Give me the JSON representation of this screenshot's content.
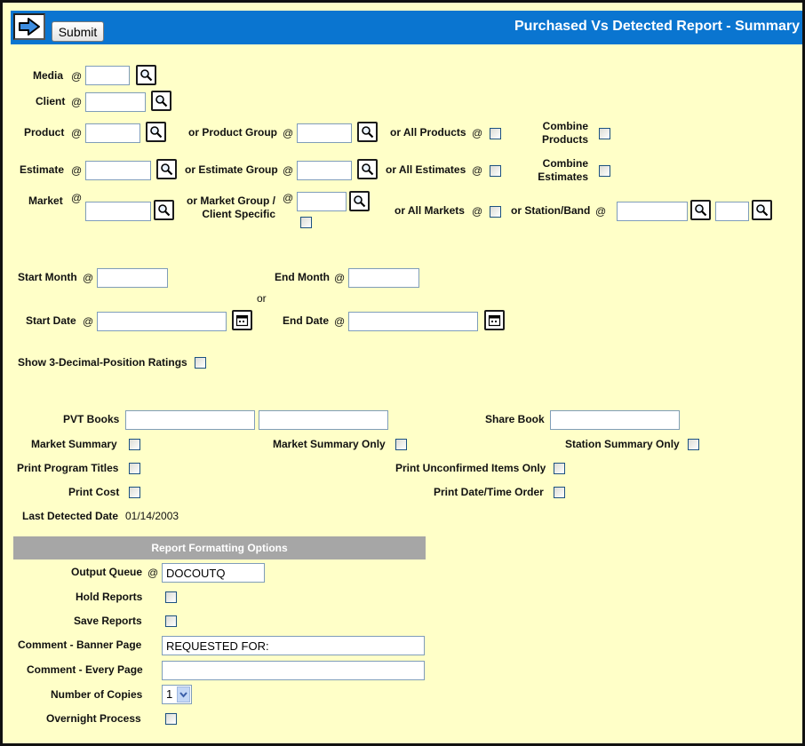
{
  "header": {
    "title": "Purchased Vs Detected Report - Summary",
    "submit_label": "Submit"
  },
  "at": "@",
  "labels": {
    "media": "Media",
    "client": "Client",
    "product": "Product",
    "product_group": "or Product Group",
    "all_products": "or All Products",
    "combine_products_1": "Combine",
    "combine_products_2": "Products",
    "estimate": "Estimate",
    "estimate_group": "or Estimate Group",
    "all_estimates": "or All Estimates",
    "combine_estimates_1": "Combine",
    "combine_estimates_2": "Estimates",
    "market": "Market",
    "market_group_1": "or Market Group /",
    "market_group_2": "Client Specific",
    "all_markets": "or All Markets",
    "station_band": "or Station/Band",
    "start_month": "Start Month",
    "end_month": "End Month",
    "or": "or",
    "start_date": "Start Date",
    "end_date": "End Date",
    "show_3_decimal": "Show 3-Decimal-Position Ratings",
    "pvt_books": "PVT Books",
    "share_book": "Share Book",
    "market_summary": "Market Summary",
    "market_summary_only": "Market Summary Only",
    "station_summary_only": "Station Summary Only",
    "print_program_titles": "Print Program Titles",
    "print_unconfirmed": "Print Unconfirmed Items Only",
    "print_cost": "Print Cost",
    "print_date_time": "Print Date/Time Order",
    "last_detected_date": "Last Detected Date"
  },
  "values": {
    "last_detected_date": "01/14/2003"
  },
  "formatting": {
    "title": "Report Formatting Options",
    "output_queue_label": "Output Queue",
    "output_queue_value": "DOCOUTQ",
    "hold_reports_label": "Hold Reports",
    "save_reports_label": "Save Reports",
    "comment_banner_label": "Comment - Banner Page",
    "comment_banner_value": "REQUESTED FOR:",
    "comment_every_label": "Comment - Every Page",
    "comment_every_value": "",
    "copies_label": "Number of Copies",
    "copies_value": "1",
    "overnight_label": "Overnight Process"
  },
  "icons": {
    "nav": "arrow-right-icon",
    "lookup": "magnifier-icon",
    "calendar": "calendar-icon"
  },
  "colors": {
    "header_bg": "#0a75d0",
    "page_bg": "#ffffc8",
    "section_header_bg": "#a6a6a6"
  }
}
